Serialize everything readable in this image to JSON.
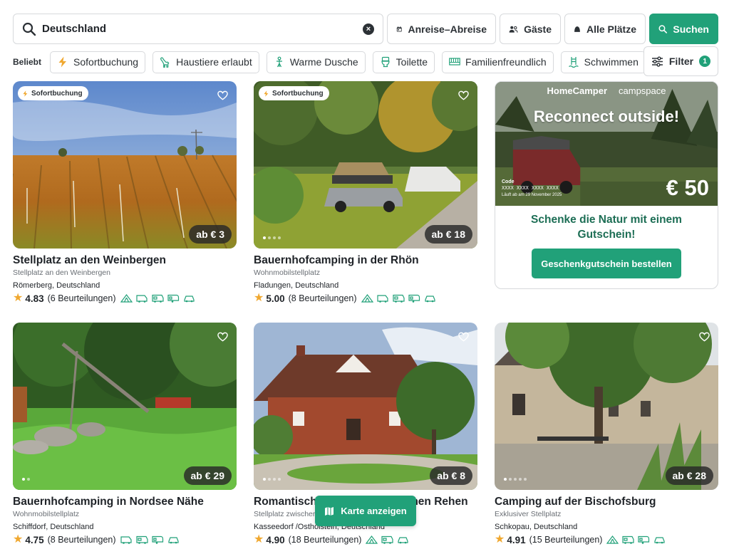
{
  "search": {
    "value": "Deutschland",
    "dates_label": "Anreise–Abreise",
    "guests_label": "Gäste",
    "places_label": "Alle Plätze",
    "search_label": "Suchen"
  },
  "filters": {
    "popular_label": "Beliebt",
    "chips": [
      {
        "label": "Sofortbuchung",
        "icon": "lightning-icon"
      },
      {
        "label": "Haustiere erlaubt",
        "icon": "dog-icon"
      },
      {
        "label": "Warme Dusche",
        "icon": "shower-icon"
      },
      {
        "label": "Toilette",
        "icon": "toilet-icon"
      },
      {
        "label": "Familienfreundlich",
        "icon": "family-icon"
      },
      {
        "label": "Schwimmen",
        "icon": "swimming-icon"
      }
    ],
    "filter_label": "Filter",
    "filter_count": "1"
  },
  "colors": {
    "accent": "#21a179",
    "promo_text": "#1d6e55",
    "star": "#f0a830"
  },
  "listings": [
    {
      "title": "Stellplatz an den Weinbergen",
      "subtitle": "Stellplatz an den Weinbergen",
      "location": "Römerberg, Deutschland",
      "score": "4.83",
      "reviews": "(6 Beurteilungen)",
      "price": "ab € 3",
      "instant_label": "Sofortbuchung"
    },
    {
      "title": "Bauernhofcamping in der Rhön",
      "subtitle": "Wohnmobilstellplatz",
      "location": "Fladungen, Deutschland",
      "score": "5.00",
      "reviews": "(8 Beurteilungen)",
      "price": "ab € 18",
      "instant_label": "Sofortbuchung"
    },
    {
      "title": "Bauernhofcamping in Nordsee Nähe",
      "subtitle": "Wohnmobilstellplatz",
      "location": "Schiffdorf, Deutschland",
      "score": "4.75",
      "reviews": "(8 Beurteilungen)",
      "price": "ab € 29"
    },
    {
      "title": "Romantisch",
      "title_tail": "chen Rehen",
      "subtitle": "Stellplatz zwischer",
      "location": "Kasseedorf /Ostholstein, Deutschland",
      "score": "4.90",
      "reviews": "(18 Beurteilungen)",
      "price": "ab € 8"
    },
    {
      "title": "Camping auf der Bischofsburg",
      "subtitle": "Exklusiver Stellplatz",
      "location": "Schkopau, Deutschland",
      "score": "4.91",
      "reviews": "(15 Beurteilungen)",
      "price": "ab € 28"
    }
  ],
  "promo": {
    "brand_1": "HomeCamper",
    "brand_2": "campspace",
    "headline": "Reconnect outside!",
    "code_label": "Code",
    "code_value": "XXXX XXXX XXXX XXXX",
    "code_expiry": "Läuft ab am 29 November 2025",
    "amount": "€ 50",
    "text": "Schenke die Natur mit einem Gutschein!",
    "button_label": "Geschenkgutschein bestellen"
  },
  "map_button_label": "Karte anzeigen"
}
